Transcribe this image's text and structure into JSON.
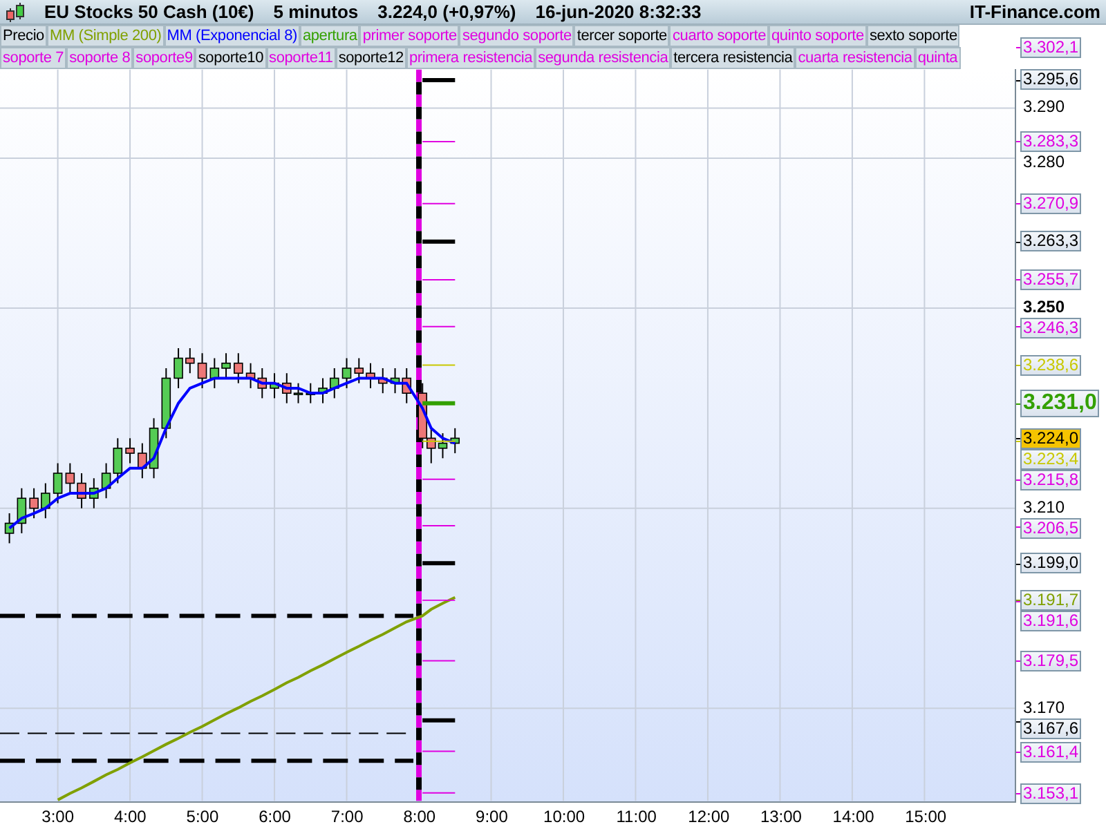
{
  "title_bar": {
    "instrument": "EU Stocks 50 Cash (10€)",
    "timeframe": "5 minutos",
    "quote": "3.224,0 (+0,97%)",
    "datetime": "16-jun-2020 8:32:33",
    "site": "IT-Finance.com"
  },
  "legend_rows": [
    [
      {
        "label": "Precio",
        "color": "#000000"
      },
      {
        "label": "apertura",
        "color": "#33a000"
      },
      {
        "label": "primer soporte",
        "color": "#e000e0"
      },
      {
        "label": "segundo soporte",
        "color": "#e000e0"
      },
      {
        "label": "tercer soporte",
        "color": "#000000"
      },
      {
        "label": "cuarto soporte",
        "color": "#e000e0"
      },
      {
        "label": "quinto soporte",
        "color": "#e000e0"
      },
      {
        "label": "sexto soporte",
        "color": "#000000"
      }
    ],
    [
      {
        "label": "soporte 7",
        "color": "#e000e0"
      },
      {
        "label": "soporte 8",
        "color": "#e000e0"
      },
      {
        "label": "soporte9",
        "color": "#e000e0"
      },
      {
        "label": "soporte10",
        "color": "#000000"
      },
      {
        "label": "soporte11",
        "color": "#e000e0"
      },
      {
        "label": "soporte12",
        "color": "#000000"
      },
      {
        "label": "primera resistencia",
        "color": "#e000e0"
      },
      {
        "label": "segunda resistencia",
        "color": "#e000e0"
      },
      {
        "label": "tercera resistencia",
        "color": "#000000"
      },
      {
        "label": "cuarta resistencia",
        "color": "#e000e0"
      },
      {
        "label": "quinta",
        "color": "#e000e0"
      }
    ]
  ],
  "current_price": {
    "label": "3.224,0"
  },
  "chart": {
    "chart_data": {
      "type": "candlestick",
      "grid": true,
      "legend": "right",
      "x": [
        2.33,
        2.5,
        2.67,
        2.83,
        3,
        3.17,
        3.33,
        3.5,
        3.67,
        3.83,
        4,
        4.17,
        4.33,
        4.5,
        4.67,
        4.83,
        5,
        5.17,
        5.33,
        5.5,
        5.67,
        5.83,
        6,
        6.17,
        6.33,
        6.5,
        6.67,
        6.83,
        7,
        7.17,
        7.33,
        7.5,
        7.67,
        7.83,
        8.05,
        8.17,
        8.33,
        8.5
      ],
      "ohlc": [
        [
          3205,
          3209,
          3203,
          3207
        ],
        [
          3207,
          3214,
          3205,
          3212
        ],
        [
          3212,
          3214,
          3208,
          3210
        ],
        [
          3210,
          3215,
          3208,
          3213
        ],
        [
          3213,
          3219,
          3211,
          3217
        ],
        [
          3217,
          3219,
          3213,
          3215
        ],
        [
          3215,
          3217,
          3210,
          3212
        ],
        [
          3212,
          3216,
          3210,
          3214
        ],
        [
          3214,
          3219,
          3212,
          3217
        ],
        [
          3217,
          3224,
          3215,
          3222
        ],
        [
          3222,
          3224,
          3219,
          3221
        ],
        [
          3221,
          3223,
          3216,
          3218
        ],
        [
          3218,
          3228,
          3216,
          3226
        ],
        [
          3226,
          3238,
          3224,
          3236
        ],
        [
          3236,
          3242,
          3234,
          3240
        ],
        [
          3240,
          3242,
          3237,
          3239
        ],
        [
          3239,
          3241,
          3234,
          3236
        ],
        [
          3236,
          3240,
          3234,
          3238
        ],
        [
          3238,
          3241,
          3236,
          3239
        ],
        [
          3239,
          3241,
          3235,
          3237
        ],
        [
          3237,
          3239,
          3234,
          3236
        ],
        [
          3236,
          3238,
          3232,
          3234
        ],
        [
          3234,
          3237,
          3232,
          3235
        ],
        [
          3235,
          3237,
          3231,
          3233
        ],
        [
          3233,
          3235,
          3231,
          3233
        ],
        [
          3233,
          3235,
          3231,
          3233
        ],
        [
          3233,
          3236,
          3231,
          3234
        ],
        [
          3234,
          3238,
          3232,
          3236
        ],
        [
          3236,
          3240,
          3234,
          3238
        ],
        [
          3238,
          3240,
          3235,
          3237
        ],
        [
          3237,
          3239,
          3234,
          3236
        ],
        [
          3236,
          3238,
          3233,
          3235
        ],
        [
          3235,
          3238,
          3233,
          3236
        ],
        [
          3236,
          3238,
          3231,
          3233
        ],
        [
          3233,
          3235,
          3222,
          3224
        ],
        [
          3224,
          3226,
          3219,
          3222
        ],
        [
          3222,
          3225,
          3220,
          3223
        ],
        [
          3223,
          3226,
          3221,
          3224
        ]
      ],
      "series": [
        {
          "name": "MM (Simple 200)",
          "type": "line",
          "color": "#80a000",
          "values": [
            null,
            null,
            null,
            null,
            3151.7,
            3153.0,
            3154.1,
            3155.4,
            3156.7,
            3157.8,
            3159.1,
            3160.3,
            3161.5,
            3162.8,
            3164.0,
            3165.2,
            3166.4,
            3167.7,
            3168.9,
            3170.1,
            3171.4,
            3172.5,
            3173.8,
            3175.1,
            3176.2,
            3177.5,
            3178.7,
            3179.9,
            3181.2,
            3182.4,
            3183.6,
            3184.8,
            3186.1,
            3187.3,
            3188.5,
            3189.8,
            3191.0,
            3192.2
          ]
        },
        {
          "name": "MM (Exponencial 8)",
          "type": "line",
          "color": "#0000ff",
          "values": [
            3206,
            3208,
            3209,
            3210,
            3212,
            3213,
            3213,
            3213,
            3214,
            3216,
            3218,
            3218,
            3220,
            3226,
            3231,
            3234,
            3235,
            3236,
            3236,
            3236,
            3236,
            3235,
            3235,
            3234,
            3234,
            3233,
            3233,
            3234,
            3235,
            3236,
            3236,
            3236,
            3235,
            3235,
            3230,
            3226,
            3224,
            3223
          ]
        },
        {
          "name": "3.295,6",
          "type": "line",
          "color": "#000000",
          "values": [
            null,
            null,
            null,
            null,
            null,
            null,
            null,
            null,
            null,
            null,
            null,
            null,
            null,
            null,
            null,
            null,
            null,
            null,
            null,
            null,
            null,
            null,
            null,
            null,
            null,
            null,
            null,
            null,
            null,
            null,
            null,
            null,
            null,
            null,
            3295.6,
            3295.6,
            3295.6,
            3295.6
          ]
        },
        {
          "name": "3.283,3",
          "type": "line",
          "color": "#e000e0",
          "values": [
            null,
            null,
            null,
            null,
            null,
            null,
            null,
            null,
            null,
            null,
            null,
            null,
            null,
            null,
            null,
            null,
            null,
            null,
            null,
            null,
            null,
            null,
            null,
            null,
            null,
            null,
            null,
            null,
            null,
            null,
            null,
            null,
            null,
            null,
            3283.3,
            3283.3,
            3283.3,
            3283.3
          ]
        },
        {
          "name": "3.270,9",
          "type": "line",
          "color": "#e000e0",
          "values": [
            null,
            null,
            null,
            null,
            null,
            null,
            null,
            null,
            null,
            null,
            null,
            null,
            null,
            null,
            null,
            null,
            null,
            null,
            null,
            null,
            null,
            null,
            null,
            null,
            null,
            null,
            null,
            null,
            null,
            null,
            null,
            null,
            null,
            null,
            3270.9,
            3270.9,
            3270.9,
            3270.9
          ]
        },
        {
          "name": "3.263,3",
          "type": "line",
          "color": "#000000",
          "values": [
            null,
            null,
            null,
            null,
            null,
            null,
            null,
            null,
            null,
            null,
            null,
            null,
            null,
            null,
            null,
            null,
            null,
            null,
            null,
            null,
            null,
            null,
            null,
            null,
            null,
            null,
            null,
            null,
            null,
            null,
            null,
            null,
            null,
            null,
            3263.3,
            3263.3,
            3263.3,
            3263.3
          ]
        },
        {
          "name": "3.255,7",
          "type": "line",
          "color": "#e000e0",
          "values": [
            null,
            null,
            null,
            null,
            null,
            null,
            null,
            null,
            null,
            null,
            null,
            null,
            null,
            null,
            null,
            null,
            null,
            null,
            null,
            null,
            null,
            null,
            null,
            null,
            null,
            null,
            null,
            null,
            null,
            null,
            null,
            null,
            null,
            null,
            3255.7,
            3255.7,
            3255.7,
            3255.7
          ]
        },
        {
          "name": "3.246,3",
          "type": "line",
          "color": "#e000e0",
          "values": [
            null,
            null,
            null,
            null,
            null,
            null,
            null,
            null,
            null,
            null,
            null,
            null,
            null,
            null,
            null,
            null,
            null,
            null,
            null,
            null,
            null,
            null,
            null,
            null,
            null,
            null,
            null,
            null,
            null,
            null,
            null,
            null,
            null,
            null,
            3246.3,
            3246.3,
            3246.3,
            3246.3
          ]
        },
        {
          "name": "3.238,6",
          "type": "line",
          "color": "#c8c800",
          "values": [
            null,
            null,
            null,
            null,
            null,
            null,
            null,
            null,
            null,
            null,
            null,
            null,
            null,
            null,
            null,
            null,
            null,
            null,
            null,
            null,
            null,
            null,
            null,
            null,
            null,
            null,
            null,
            null,
            null,
            null,
            null,
            null,
            null,
            null,
            3238.6,
            3238.6,
            3238.6,
            3238.6
          ]
        },
        {
          "name": "3.231,0",
          "type": "line",
          "color": "#33a000",
          "values": [
            null,
            null,
            null,
            null,
            null,
            null,
            null,
            null,
            null,
            null,
            null,
            null,
            null,
            null,
            null,
            null,
            null,
            null,
            null,
            null,
            null,
            null,
            null,
            null,
            null,
            null,
            null,
            null,
            null,
            null,
            null,
            null,
            null,
            null,
            3231.0,
            3231.0,
            3231.0,
            3231.0
          ]
        },
        {
          "name": "3.223,4",
          "type": "line",
          "color": "#c8c800",
          "values": [
            null,
            null,
            null,
            null,
            null,
            null,
            null,
            null,
            null,
            null,
            null,
            null,
            null,
            null,
            null,
            null,
            null,
            null,
            null,
            null,
            null,
            null,
            null,
            null,
            null,
            null,
            null,
            null,
            null,
            null,
            null,
            null,
            null,
            null,
            3223.4,
            3223.4,
            3223.4,
            3223.4
          ]
        },
        {
          "name": "3.215,8",
          "type": "line",
          "color": "#e000e0",
          "values": [
            null,
            null,
            null,
            null,
            null,
            null,
            null,
            null,
            null,
            null,
            null,
            null,
            null,
            null,
            null,
            null,
            null,
            null,
            null,
            null,
            null,
            null,
            null,
            null,
            null,
            null,
            null,
            null,
            null,
            null,
            null,
            null,
            null,
            null,
            3215.8,
            3215.8,
            3215.8,
            3215.8
          ]
        },
        {
          "name": "3.206,5",
          "type": "line",
          "color": "#e000e0",
          "values": [
            null,
            null,
            null,
            null,
            null,
            null,
            null,
            null,
            null,
            null,
            null,
            null,
            null,
            null,
            null,
            null,
            null,
            null,
            null,
            null,
            null,
            null,
            null,
            null,
            null,
            null,
            null,
            null,
            null,
            null,
            null,
            null,
            null,
            null,
            3206.5,
            3206.5,
            3206.5,
            3206.5
          ]
        },
        {
          "name": "3.199,0",
          "type": "line",
          "color": "#000000",
          "values": [
            null,
            null,
            null,
            null,
            null,
            null,
            null,
            null,
            null,
            null,
            null,
            null,
            null,
            null,
            null,
            null,
            null,
            null,
            null,
            null,
            null,
            null,
            null,
            null,
            null,
            null,
            null,
            null,
            null,
            null,
            null,
            null,
            null,
            null,
            3199.0,
            3199.0,
            3199.0,
            3199.0
          ]
        },
        {
          "name": "3.191,6",
          "type": "line",
          "color": "#e000e0",
          "values": [
            null,
            null,
            null,
            null,
            null,
            null,
            null,
            null,
            null,
            null,
            null,
            null,
            null,
            null,
            null,
            null,
            null,
            null,
            null,
            null,
            null,
            null,
            null,
            null,
            null,
            null,
            null,
            null,
            null,
            null,
            null,
            null,
            null,
            null,
            3191.6,
            3191.6,
            3191.6,
            3191.6
          ]
        },
        {
          "name": "3.179,5",
          "type": "line",
          "color": "#e000e0",
          "values": [
            null,
            null,
            null,
            null,
            null,
            null,
            null,
            null,
            null,
            null,
            null,
            null,
            null,
            null,
            null,
            null,
            null,
            null,
            null,
            null,
            null,
            null,
            null,
            null,
            null,
            null,
            null,
            null,
            null,
            null,
            null,
            null,
            null,
            null,
            3179.5,
            3179.5,
            3179.5,
            3179.5
          ]
        },
        {
          "name": "3.167,6",
          "type": "line",
          "color": "#000000",
          "values": [
            null,
            null,
            null,
            null,
            null,
            null,
            null,
            null,
            null,
            null,
            null,
            null,
            null,
            null,
            null,
            null,
            null,
            null,
            null,
            null,
            null,
            null,
            null,
            null,
            null,
            null,
            null,
            null,
            null,
            null,
            null,
            null,
            null,
            null,
            3167.6,
            3167.6,
            3167.6,
            3167.6
          ]
        },
        {
          "name": "3.161,4",
          "type": "line",
          "color": "#e000e0",
          "values": [
            null,
            null,
            null,
            null,
            null,
            null,
            null,
            null,
            null,
            null,
            null,
            null,
            null,
            null,
            null,
            null,
            null,
            null,
            null,
            null,
            null,
            null,
            null,
            null,
            null,
            null,
            null,
            null,
            null,
            null,
            null,
            null,
            null,
            null,
            3161.4,
            3161.4,
            3161.4,
            3161.4
          ]
        },
        {
          "name": "3.153,1",
          "type": "line",
          "color": "#e000e0",
          "values": [
            null,
            null,
            null,
            null,
            null,
            null,
            null,
            null,
            null,
            null,
            null,
            null,
            null,
            null,
            null,
            null,
            null,
            null,
            null,
            null,
            null,
            null,
            null,
            null,
            null,
            null,
            null,
            null,
            null,
            null,
            null,
            null,
            null,
            null,
            3153.1,
            3153.1,
            3153.1,
            3153.1
          ]
        }
      ],
      "xlim": [
        2.2,
        16.25
      ],
      "ylim": [
        3151.5,
        3297.7
      ],
      "xticks": [
        {
          "value": 3,
          "label": "3:00"
        },
        {
          "value": 4,
          "label": "4:00"
        },
        {
          "value": 5,
          "label": "5:00"
        },
        {
          "value": 6,
          "label": "6:00"
        },
        {
          "value": 7,
          "label": "7:00"
        },
        {
          "value": 8,
          "label": "8:00"
        },
        {
          "value": 9,
          "label": "9:00"
        },
        {
          "value": 10,
          "label": "10:00"
        },
        {
          "value": 11,
          "label": "11:00"
        },
        {
          "value": 12,
          "label": "12:00"
        },
        {
          "value": 13,
          "label": "13:00"
        },
        {
          "value": 14,
          "label": "14:00"
        },
        {
          "value": 15,
          "label": "15:00"
        }
      ],
      "yticks": [
        {
          "value": 3290,
          "label": "3.290"
        },
        {
          "value": 3280,
          "label": "3.280"
        },
        {
          "value": 3250,
          "label": "3.250"
        },
        {
          "value": 3210,
          "label": "3.210"
        },
        {
          "value": 3170,
          "label": "3.170"
        }
      ],
      "ref_lines": [
        {
          "axis": "x",
          "value": 8.0,
          "color": "#e000e0",
          "line_style": "dashed"
        },
        {
          "axis": "x",
          "value": 8.0,
          "color": "#000000",
          "line_style": "dashed"
        },
        {
          "axis": "y",
          "value": 3188.5,
          "color": "#000000",
          "line_style": "dashed"
        },
        {
          "axis": "y",
          "value": 3165,
          "color": "#000000",
          "line_style": "dashed"
        },
        {
          "axis": "y",
          "value": 3159.5,
          "color": "#000000",
          "line_style": "dashed"
        },
        {
          "axis": "y",
          "value": 3302.1,
          "label": "3.302,1",
          "color": "#e000e0"
        },
        {
          "axis": "y",
          "value": 3191.7,
          "label": "3.191,7",
          "color": "#80a000"
        }
      ]
    }
  }
}
